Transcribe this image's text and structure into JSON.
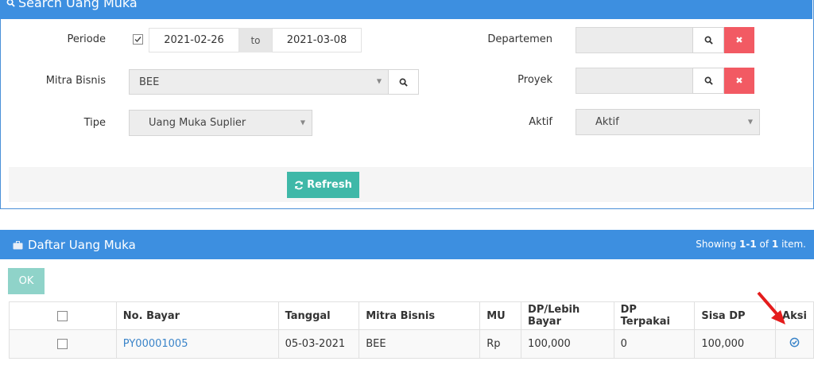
{
  "search_panel": {
    "title": "Search Uang Muka",
    "periode_label": "Periode",
    "date_from": "2021-02-26",
    "to_label": "to",
    "date_to": "2021-03-08",
    "mitra_label": "Mitra Bisnis",
    "mitra_value": "BEE",
    "tipe_label": "Tipe",
    "tipe_value": "Uang Muka Suplier",
    "departemen_label": "Departemen",
    "proyek_label": "Proyek",
    "aktif_label": "Aktif",
    "aktif_value": "Aktif",
    "refresh_label": "Refresh"
  },
  "list_panel": {
    "title": "Daftar Uang Muka",
    "showing_prefix": "Showing ",
    "showing_range": "1-1",
    "showing_of": " of ",
    "showing_total": "1",
    "showing_suffix": " item.",
    "ok_label": "OK",
    "columns": [
      "No. Bayar",
      "Tanggal",
      "Mitra Bisnis",
      "MU",
      "DP/Lebih Bayar",
      "DP Terpakai",
      "Sisa DP",
      "Aksi"
    ],
    "rows": [
      {
        "no_bayar": "PY00001005",
        "tanggal": "05-03-2021",
        "mitra": "BEE",
        "mu": "Rp",
        "dp_lebih": "100,000",
        "dp_terpakai": "0",
        "sisa_dp": "100,000"
      }
    ]
  },
  "colors": {
    "header_blue": "#3d8fe0",
    "teal": "#3fb8a8",
    "danger": "#f25a63",
    "link": "#3a84c9"
  },
  "icons": {
    "search": "search-icon",
    "close": "close-icon",
    "refresh": "refresh-icon",
    "briefcase": "briefcase-icon",
    "check": "check-circle-icon"
  }
}
